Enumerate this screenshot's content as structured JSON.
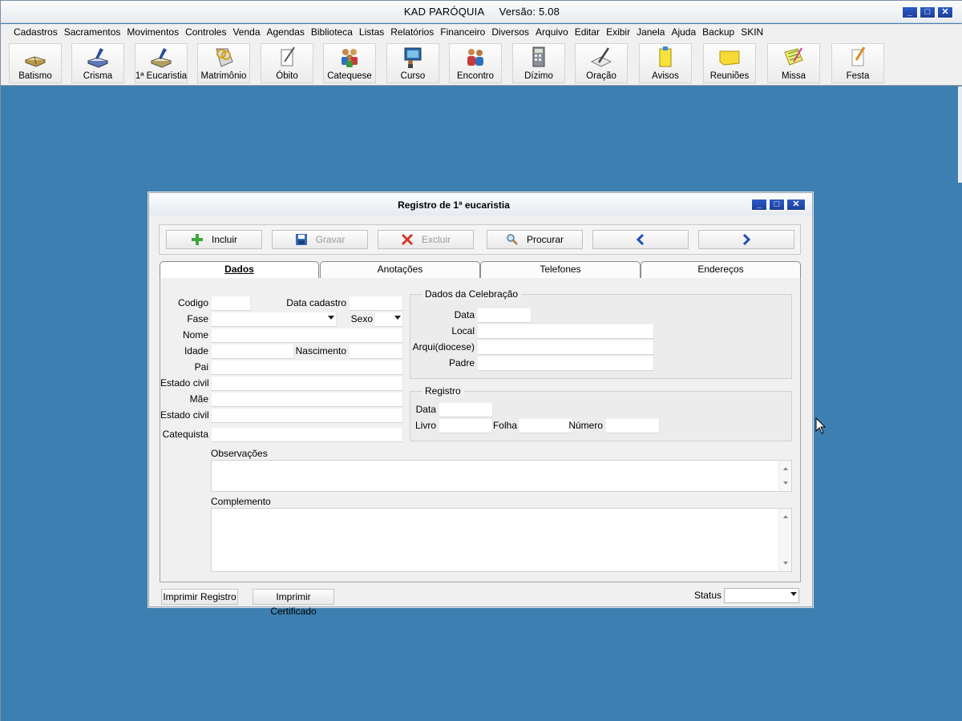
{
  "app": {
    "title": "KAD PARÓQUIA     Versão: 5.08"
  },
  "menu": [
    "Cadastros",
    "Sacramentos",
    "Movimentos",
    "Controles",
    "Venda",
    "Agendas",
    "Biblioteca",
    "Listas",
    "Relatórios",
    "Financeiro",
    "Diversos",
    "Arquivo",
    "Editar",
    "Exibir",
    "Janela",
    "Ajuda",
    "Backup",
    "SKIN"
  ],
  "toolbar": [
    {
      "label": "Batismo",
      "icon": "book-icon"
    },
    {
      "label": "Crisma",
      "icon": "book-pen-icon"
    },
    {
      "label": "1ª Eucaristia",
      "icon": "book-pen-icon"
    },
    {
      "label": "Matrimônio",
      "icon": "rings-icon"
    },
    {
      "label": "Óbito",
      "icon": "quill-paper-icon"
    },
    {
      "label": "Catequese",
      "icon": "group-icon"
    },
    {
      "label": "Curso",
      "icon": "presentation-icon"
    },
    {
      "label": "Encontro",
      "icon": "people-icon"
    },
    {
      "label": "Dízimo",
      "icon": "calculator-icon"
    },
    {
      "label": "Oração",
      "icon": "pen-writing-icon"
    },
    {
      "label": "Avisos",
      "icon": "note-icon"
    },
    {
      "label": "Reuniões",
      "icon": "sticky-note-icon"
    },
    {
      "label": "Missa",
      "icon": "notebook-icon"
    },
    {
      "label": "Festa",
      "icon": "pencil-paper-icon"
    }
  ],
  "dialog": {
    "title": "Registro de 1ª eucaristia",
    "actions": {
      "incluir": "Incluir",
      "gravar": "Gravar",
      "excluir": "Excluir",
      "procurar": "Procurar"
    },
    "tabs": [
      "Dados",
      "Anotações",
      "Telefones",
      "Endereços"
    ],
    "labels": {
      "codigo": "Codigo",
      "data_cadastro": "Data cadastro",
      "fase": "Fase",
      "sexo": "Sexo",
      "nome": "Nome",
      "idade": "Idade",
      "nascimento": "Nascimento",
      "pai": "Pai",
      "estado_civil_pai": "Estado civil",
      "mae": "Mãe",
      "estado_civil_mae": "Estado civil",
      "catequista": "Catequista",
      "observacoes": "Observações",
      "complemento": "Complemento"
    },
    "celebracao": {
      "title": "Dados da Celebração",
      "data": "Data",
      "local": "Local",
      "arquidiocese": "Arqui(diocese)",
      "padre": "Padre"
    },
    "registro": {
      "title": "Registro",
      "data": "Data",
      "livro": "Livro",
      "folha": "Folha",
      "numero": "Número"
    },
    "bottom": {
      "imprimir_registro": "Imprimir Registro",
      "imprimir_certificado": "Imprimir Certificado",
      "status": "Status"
    }
  }
}
